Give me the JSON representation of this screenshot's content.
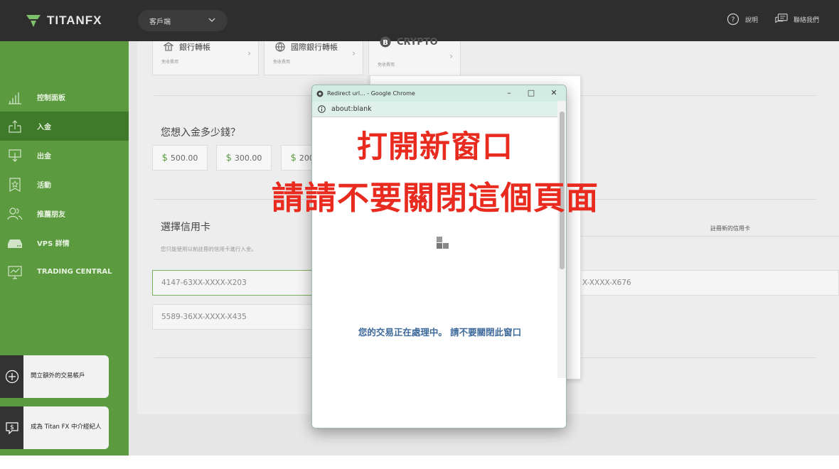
{
  "header": {
    "logo_text": "TITANFX",
    "portal_select": "客戶端",
    "help_label": "說明",
    "contact_label": "聯絡我們"
  },
  "sidebar": {
    "items": [
      {
        "label": "控制面板",
        "icon": "bar-chart-icon"
      },
      {
        "label": "入金",
        "icon": "deposit-icon"
      },
      {
        "label": "出金",
        "icon": "withdraw-icon"
      },
      {
        "label": "活動",
        "icon": "badge-icon"
      },
      {
        "label": "推薦朋友",
        "icon": "users-icon"
      },
      {
        "label": "VPS 詳情",
        "icon": "server-icon"
      },
      {
        "label": "TRADING CENTRAL",
        "icon": "trading-chart-icon"
      }
    ],
    "cards": [
      {
        "label": "開立額外的交易帳戶",
        "icon": "plus-circle-icon"
      },
      {
        "label": "成為 Titan FX 中介經紀人",
        "icon": "dollar-card-icon"
      }
    ]
  },
  "payment_methods": [
    {
      "label": "銀行轉帳",
      "sub": "免收費用"
    },
    {
      "label": "國際銀行轉帳",
      "sub": "免收費用"
    },
    {
      "label": "CRYPTO",
      "sub": "免收費用"
    }
  ],
  "amount_section": {
    "title": "您想入金多少錢？",
    "currency_symbol": "$",
    "amounts": [
      "500.00",
      "300.00",
      "200.00"
    ]
  },
  "card_section": {
    "title": "選擇信用卡",
    "subtitle": "您只能使用以前註冊的信用卡進行入金。",
    "register_link": "註冊新的信用卡",
    "cards": [
      "4147-63XX-XXXX-X203",
      "5589-36XX-XXXX-X435",
      "X-XXXX-X676"
    ]
  },
  "popup": {
    "window_title": "Redirect url... - Google Chrome",
    "address": "about:blank",
    "processing_text": "您的交易正在處理中。 請不要關閉此窗口"
  },
  "overlay": {
    "line1": "打開新窗口",
    "line2": "請請不要關閉這個頁面"
  },
  "colors": {
    "sidebar_green": "#5b9a3f",
    "active_green": "#3f7a2a",
    "overlay_red": "#e82a1f",
    "processing_blue": "#3d6a9a"
  }
}
